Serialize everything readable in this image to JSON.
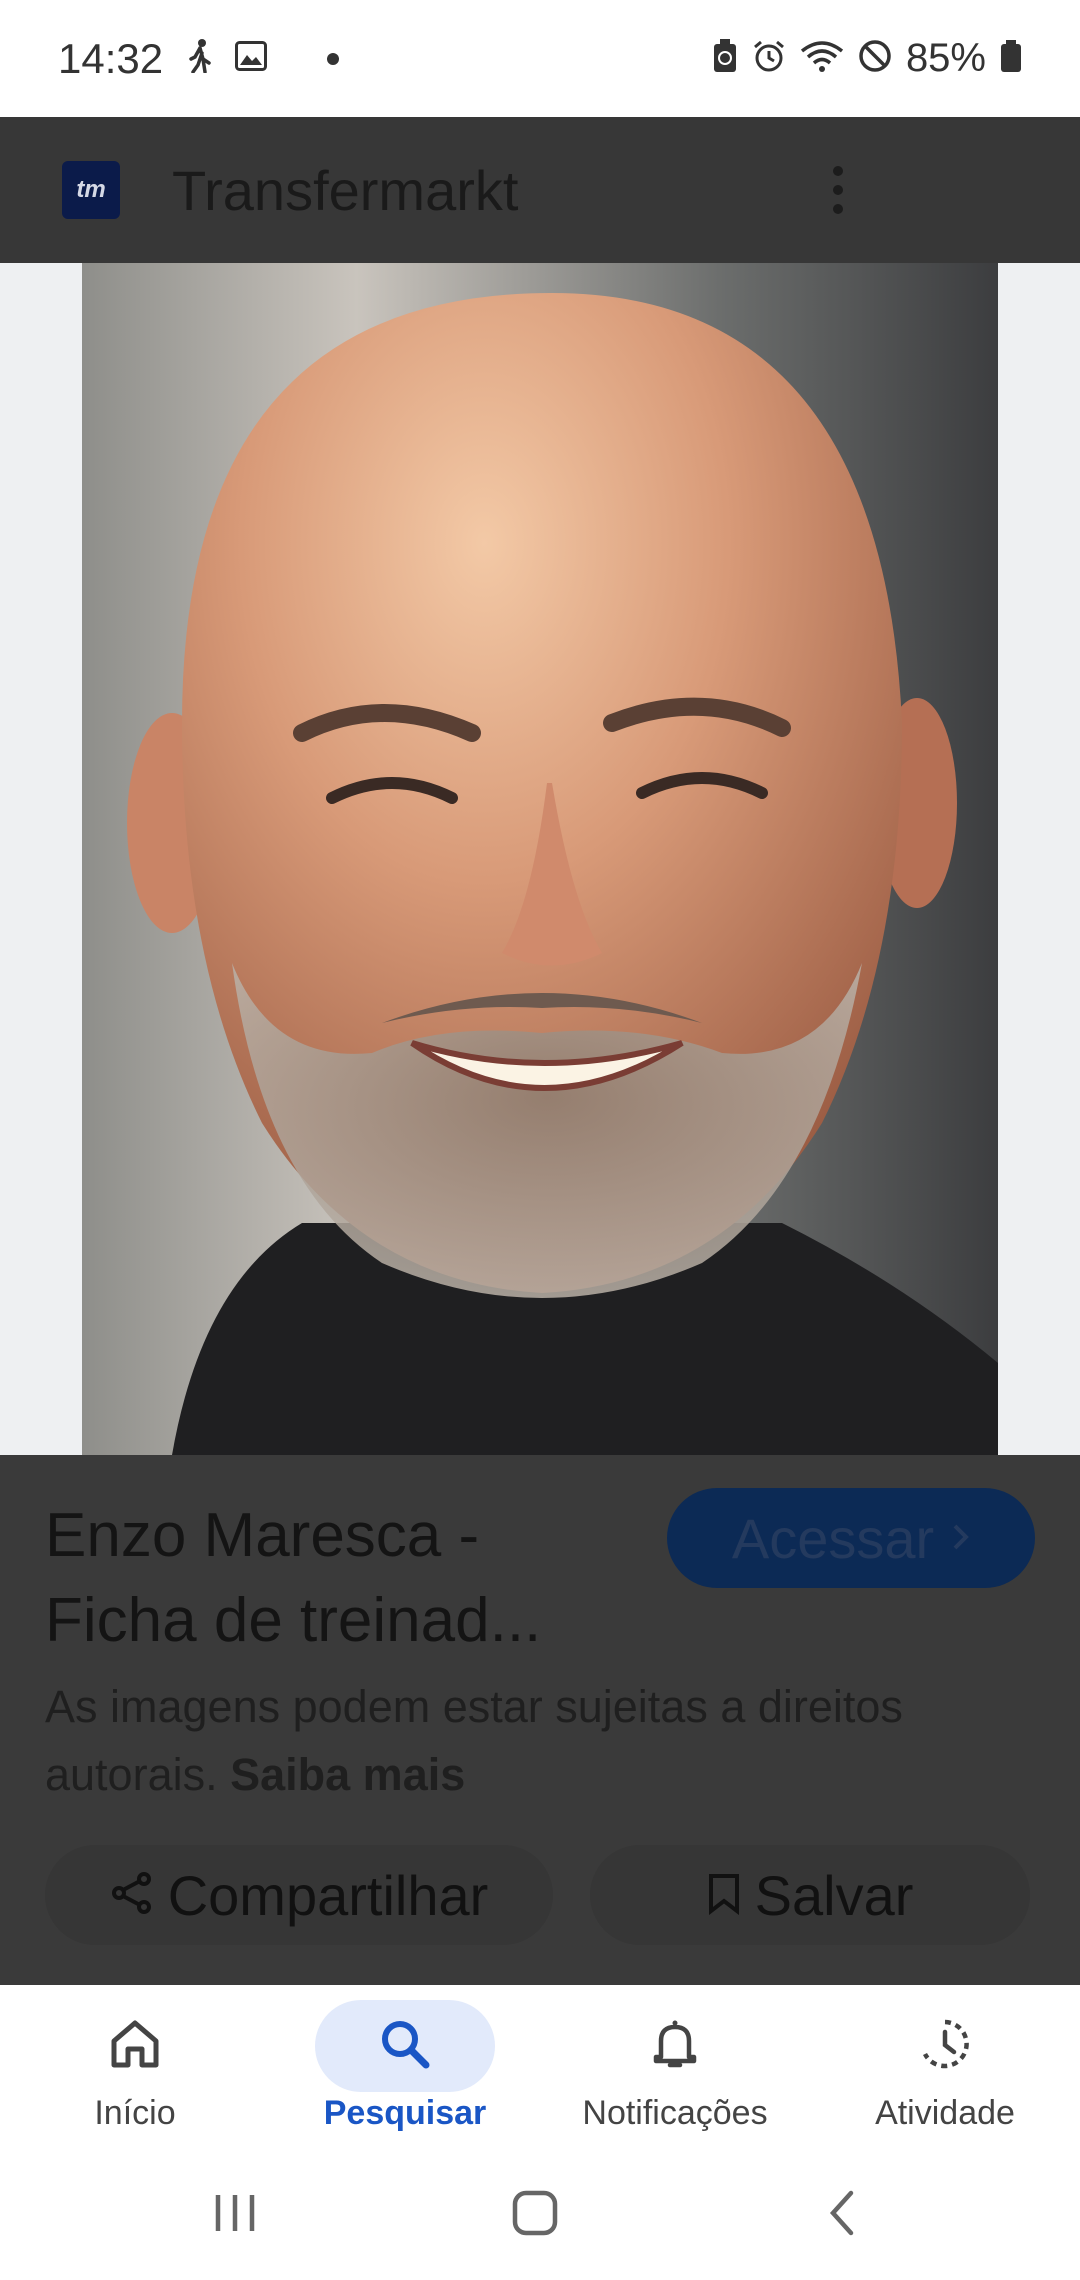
{
  "status_bar": {
    "time": "14:32",
    "battery": "85%"
  },
  "header": {
    "logo_text": "tm",
    "title": "Transfermarkt"
  },
  "result": {
    "title": "Enzo Maresca - Ficha de treinad...",
    "visit_label": "Acessar",
    "copyright_text": "As imagens podem estar sujeitas a direitos autorais.",
    "copyright_link": "Saiba mais",
    "share_label": "Compartilhar",
    "save_label": "Salvar"
  },
  "bottom_nav": {
    "items": [
      {
        "label": "Início",
        "icon": "home-icon",
        "active": false
      },
      {
        "label": "Pesquisar",
        "icon": "search-icon",
        "active": true
      },
      {
        "label": "Notificações",
        "icon": "bell-icon",
        "active": false
      },
      {
        "label": "Atividade",
        "icon": "activity-icon",
        "active": false
      }
    ]
  },
  "colors": {
    "accent": "#1a56c5",
    "active_pill": "#e2eafb",
    "overlay": "#3a3a3a"
  }
}
